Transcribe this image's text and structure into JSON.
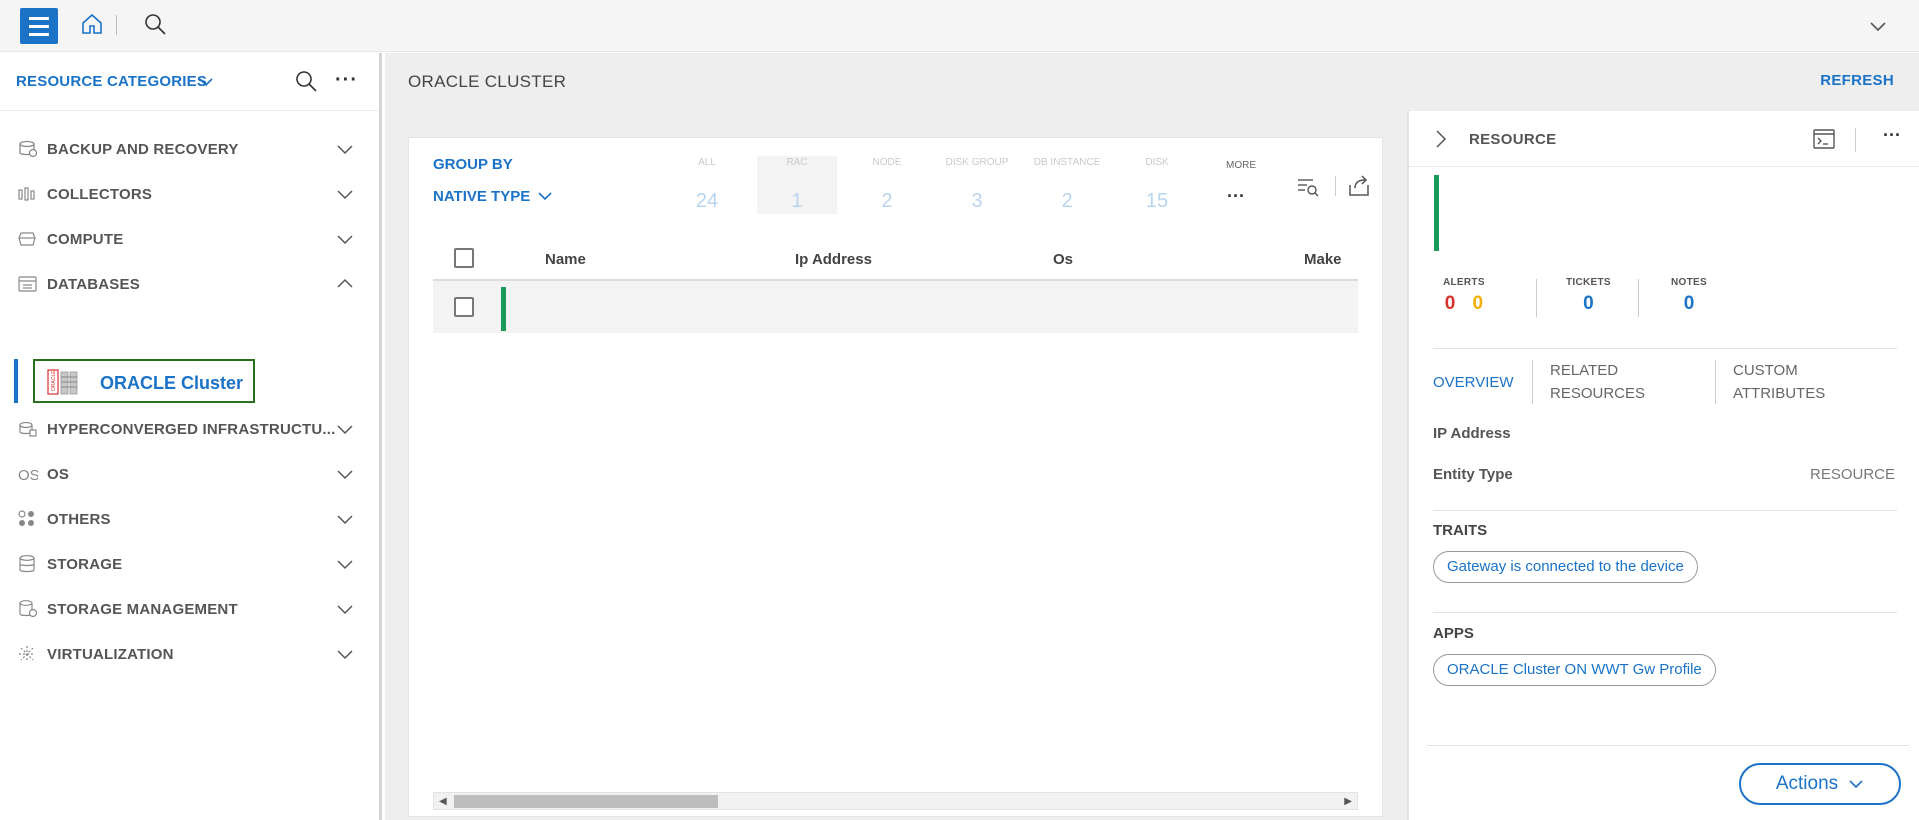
{
  "topbar": {
    "menu_icon": "hamburger-icon",
    "home_icon": "home-icon",
    "search_icon": "search-icon",
    "expand_icon": "chevron-down-icon"
  },
  "sidebar": {
    "header": {
      "title": "RESOURCE CATEGORIES"
    },
    "categories": [
      {
        "label": "BACKUP AND RECOVERY",
        "icon": "backup-icon"
      },
      {
        "label": "COLLECTORS",
        "icon": "collectors-icon"
      },
      {
        "label": "COMPUTE",
        "icon": "compute-icon"
      },
      {
        "label": "DATABASES",
        "icon": "database-icon",
        "expanded": true
      },
      {
        "label": "HYPERCONVERGED INFRASTRUCTU...",
        "icon": "hci-icon"
      },
      {
        "label": "OS",
        "icon": "os-icon"
      },
      {
        "label": "OTHERS",
        "icon": "others-icon"
      },
      {
        "label": "STORAGE",
        "icon": "storage-icon"
      },
      {
        "label": "STORAGE MANAGEMENT",
        "icon": "storage-management-icon"
      },
      {
        "label": "VIRTUALIZATION",
        "icon": "virtualization-icon"
      }
    ],
    "selected_item": {
      "label": "ORACLE Cluster",
      "icon": "oracle-cluster-icon"
    }
  },
  "main": {
    "title": "ORACLE CLUSTER",
    "refresh_label": "REFRESH",
    "grid": {
      "group_by_label": "GROUP BY",
      "group_by_value": "NATIVE TYPE",
      "type_tabs": [
        {
          "label": "ALL",
          "count": "24"
        },
        {
          "label": "RAC",
          "count": "1"
        },
        {
          "label": "NODE",
          "count": "2"
        },
        {
          "label": "DISK GROUP",
          "count": "3"
        },
        {
          "label": "DB INSTANCE",
          "count": "2"
        },
        {
          "label": "DISK",
          "count": "15"
        }
      ],
      "more_label": "MORE",
      "columns": [
        "Name",
        "Ip Address",
        "Os",
        "Make"
      ]
    }
  },
  "resource_panel": {
    "title": "RESOURCE",
    "stats": {
      "alerts_label": "ALERTS",
      "alerts_critical": "0",
      "alerts_warning": "0",
      "tickets_label": "TICKETS",
      "tickets": "0",
      "notes_label": "NOTES",
      "notes": "0"
    },
    "tabs": [
      "OVERVIEW",
      "RELATED RESOURCES",
      "CUSTOM ATTRIBUTES"
    ],
    "fields": {
      "ip_label": "IP Address",
      "entity_label": "Entity Type",
      "entity_value": "RESOURCE"
    },
    "traits_title": "TRAITS",
    "trait_chip": "Gateway is connected to the device",
    "apps_title": "APPS",
    "app_chip": "ORACLE Cluster ON WWT Gw Profile",
    "actions_label": "Actions"
  },
  "colors": {
    "accent": "#1a73c7",
    "status_green": "#1a9a5a",
    "alert_red": "#d9302b",
    "alert_yellow": "#f2b000"
  }
}
